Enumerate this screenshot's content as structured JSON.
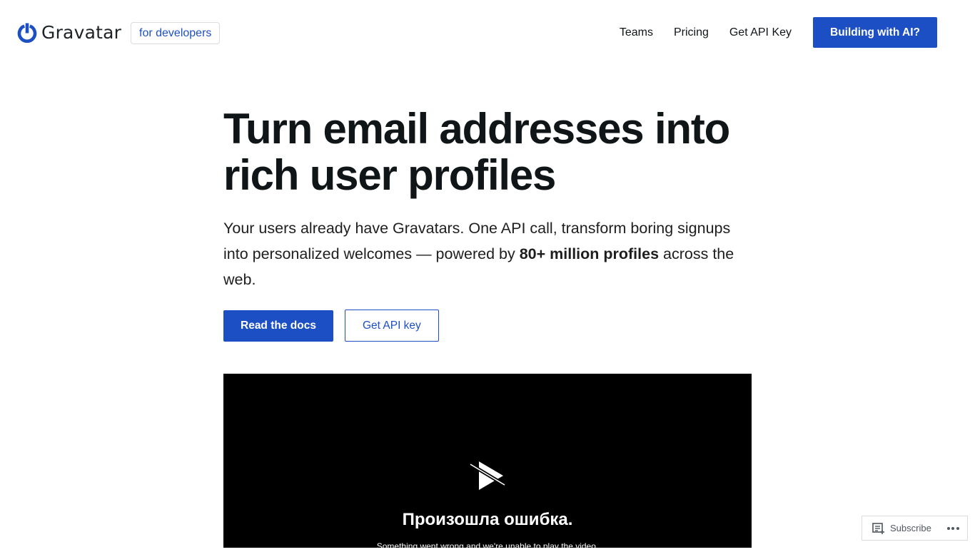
{
  "header": {
    "logo_text": "Gravatar",
    "badge": "for developers",
    "nav": [
      {
        "label": "Teams"
      },
      {
        "label": "Pricing"
      },
      {
        "label": "Get API Key"
      }
    ],
    "cta": "Building with AI?"
  },
  "hero": {
    "title": "Turn email addresses into rich user profiles",
    "description_before": "Your users already have Gravatars. One API call, transform boring signups into personalized welcomes — powered by ",
    "description_bold": "80+ million profiles",
    "description_after": " across the web.",
    "primary_button": "Read the docs",
    "secondary_button": "Get API key"
  },
  "video": {
    "error_title": "Произошла ошибка.",
    "error_message": "Something went wrong and we're unable to play the video."
  },
  "subscribe": {
    "label": "Subscribe"
  },
  "colors": {
    "accent": "#1d4fc4",
    "text": "#101517"
  }
}
